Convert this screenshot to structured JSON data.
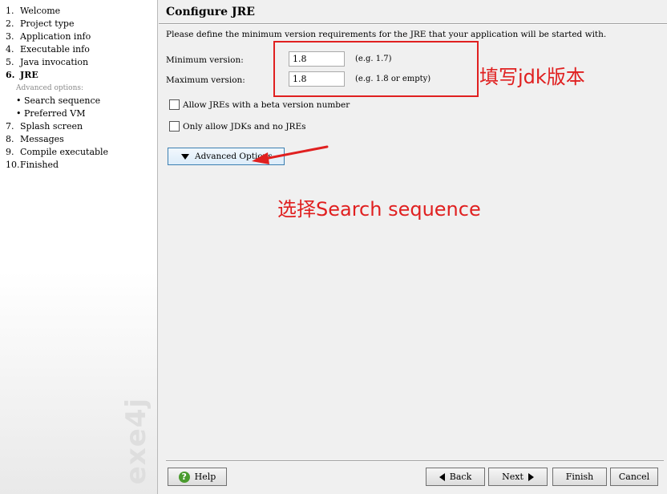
{
  "sidebar": {
    "steps": [
      {
        "num": "1.",
        "label": "Welcome"
      },
      {
        "num": "2.",
        "label": "Project type"
      },
      {
        "num": "3.",
        "label": "Application info"
      },
      {
        "num": "4.",
        "label": "Executable info"
      },
      {
        "num": "5.",
        "label": "Java invocation"
      },
      {
        "num": "6.",
        "label": "JRE"
      },
      {
        "sub_header": "Advanced options:"
      },
      {
        "sub_item": "• Search sequence"
      },
      {
        "sub_item": "• Preferred VM"
      },
      {
        "num": "7.",
        "label": "Splash screen"
      },
      {
        "num": "8.",
        "label": "Messages"
      },
      {
        "num": "9.",
        "label": "Compile executable"
      },
      {
        "num": "10.",
        "label": "Finished"
      }
    ],
    "active_step": "JRE",
    "watermark": "exe4j"
  },
  "page": {
    "title": "Configure JRE",
    "description": "Please define the minimum version requirements for the JRE that your application will be started with."
  },
  "form": {
    "min_label": "Minimum version:",
    "min_value": "1.8",
    "min_example": "(e.g. 1.7)",
    "max_label": "Maximum version:",
    "max_value": "1.8",
    "max_example": "(e.g. 1.8 or empty)",
    "beta_label": "Allow JREs with a beta version number",
    "beta_checked": false,
    "jdk_label": "Only allow JDKs and no JREs",
    "jdk_checked": false,
    "advanced_label": "Advanced Options"
  },
  "buttons": {
    "help": "Help",
    "back": "Back",
    "next": "Next",
    "finish": "Finish",
    "cancel": "Cancel"
  },
  "annotations": {
    "version_note": "填写jdk版本",
    "search_note": "选择Search sequence",
    "color": "#e02020"
  },
  "colors": {
    "accent_border": "#3c7fb1",
    "help_icon": "#4a9b2e"
  }
}
